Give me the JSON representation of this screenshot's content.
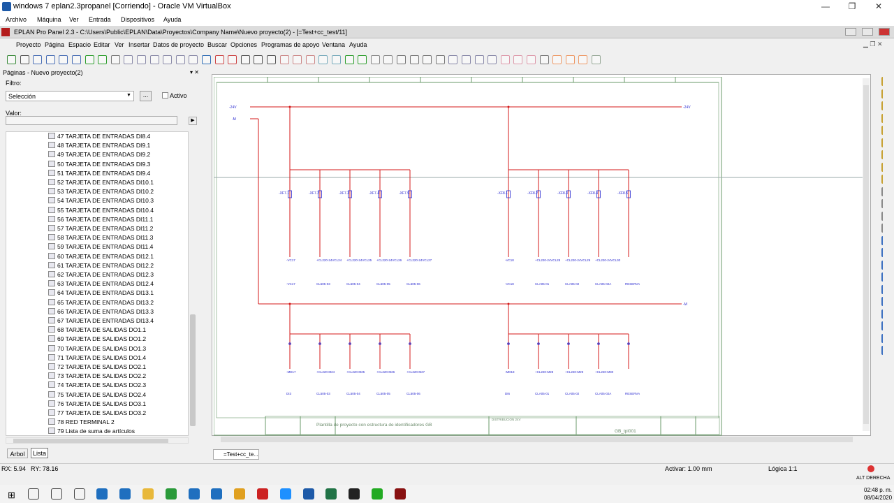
{
  "vb": {
    "title": "windows 7 eplan2.3propanel [Corriendo] - Oracle VM VirtualBox",
    "menu": [
      "Archivo",
      "Máquina",
      "Ver",
      "Entrada",
      "Dispositivos",
      "Ayuda"
    ]
  },
  "eplan": {
    "title": "EPLAN Pro Panel 2.3 - C:\\Users\\Public\\EPLAN\\Data\\Proyectos\\Company Name\\Nuevo proyecto(2) - [=Test+cc_test/11]",
    "menu": [
      "Proyecto",
      "Página",
      "Espacio",
      "Editar",
      "Ver",
      "Insertar",
      "Datos de proyecto",
      "Buscar",
      "Opciones",
      "Programas de apoyo",
      "Ventana",
      "Ayuda"
    ]
  },
  "panel": {
    "header": "Páginas - Nuevo proyecto(2)",
    "filtro_label": "Filtro:",
    "filtro_value": "Selección",
    "dots": "...",
    "activo": "Activo",
    "valor_label": "Valor:",
    "tabs": [
      "Arbol",
      "Lista"
    ],
    "items": [
      "47 TARJETA DE ENTRADAS DI8.4",
      "48 TARJETA DE ENTRADAS DI9.1",
      "49 TARJETA DE ENTRADAS DI9.2",
      "50 TARJETA DE ENTRADAS DI9.3",
      "51 TARJETA DE ENTRADAS DI9.4",
      "52 TARJETA DE ENTRADAS DI10.1",
      "53 TARJETA DE ENTRADAS DI10.2",
      "54 TARJETA DE ENTRADAS DI10.3",
      "55 TARJETA DE ENTRADAS DI10.4",
      "56 TARJETA DE ENTRADAS DI11.1",
      "57 TARJETA DE ENTRADAS DI11.2",
      "58 TARJETA DE ENTRADAS DI11.3",
      "59 TARJETA DE ENTRADAS DI11.4",
      "60 TARJETA DE ENTRADAS DI12.1",
      "61 TARJETA DE ENTRADAS DI12.2",
      "62 TARJETA DE ENTRADAS DI12.3",
      "63 TARJETA DE ENTRADAS DI12.4",
      "64 TARJETA DE ENTRADAS DI13.1",
      "65 TARJETA DE ENTRADAS DI13.2",
      "66 TARJETA DE ENTRADAS DI13.3",
      "67 TARJETA DE ENTRADAS DI13.4",
      "68 TARJETA DE SALIDAS DO1.1",
      "69 TARJETA DE SALIDAS DO1.2",
      "70 TARJETA DE SALIDAS DO1.3",
      "71 TARJETA DE SALIDAS DO1.4",
      "72 TARJETA DE SALIDAS DO2.1",
      "73 TARJETA DE SALIDAS DO2.2",
      "74 TARJETA DE SALIDAS DO2.3",
      "75 TARJETA DE SALIDAS DO2.4",
      "76 TARJETA DE SALIDAS DO3.1",
      "77 TARJETA DE SALIDAS DO3.2",
      "78 RED TERMINAL 2",
      "79 Lista de suma de artículos"
    ]
  },
  "schematic": {
    "top_left_label": "-24V",
    "top_right_label": "-24V",
    "m_left": "-M",
    "m_right": "-M",
    "xf_left": [
      "-XF7.1",
      "-XF7.2",
      "-XF7.3",
      "-XF7.4",
      "-XF7.5"
    ],
    "xf_right": [
      "-XF8.1",
      "-XF8.2",
      "-XF8.3",
      "-XF8.4",
      "-XF8.5"
    ],
    "vc_row": "-VC17",
    "vc_row_r": "-VC18",
    "cl_row1": [
      "-VC17",
      "CL505-03",
      "CL505-04",
      "CL505-05",
      "CL505-06"
    ],
    "cl_row1r": [
      "-VC18",
      "CLA05-01",
      "CLA05-02",
      "CLA05-02A",
      "RESERVA"
    ],
    "cl_row2": [
      "DI3",
      "CL505-03",
      "CL505-04",
      "CL505-05",
      "CL505-06"
    ],
    "cl_row2r": [
      "DI6",
      "CLA05-01",
      "CLA05-02",
      "CLA05-02A",
      "RESERVA"
    ],
    "mid_top": [
      "-MD17",
      "+CL220-M24",
      "+CL220-M25",
      "+CL220-M26",
      "+CL220-M27"
    ],
    "mid_top_r": [
      "-MD18",
      "+CL220-M28",
      "+CL220-M29",
      "+CL220-M30"
    ],
    "titleblock_text": "Plantilla de proyecto con estructura de identificadores GB",
    "titleblock_code": "GB_tpl001",
    "titleblock_dist": "DISTRIBUCIÓN 24V"
  },
  "sheet_tab": "=Test+cc_te...",
  "status": {
    "rx": "RX: 5.94",
    "ry": "RY: 78.16",
    "activar": "Activar: 1.00 mm",
    "logica": "Lógica 1:1"
  },
  "taskbar": {
    "time": "02:48 p. m.",
    "date": "08/04/2020",
    "kbd": "ALT DERECHA"
  }
}
